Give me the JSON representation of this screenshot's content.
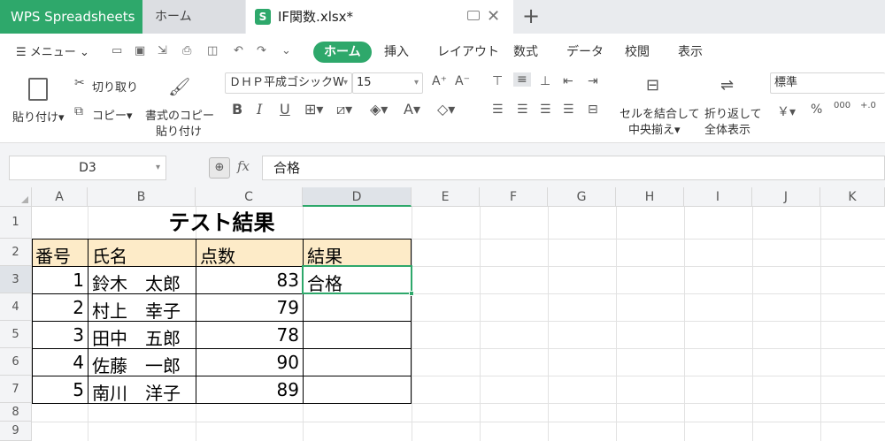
{
  "window": {
    "app_tab": "WPS Spreadsheets",
    "home_tab": "ホーム",
    "file_tab": "IF関数.xlsx*",
    "file_icon": "S"
  },
  "menubar": {
    "menu_label": "メニュー",
    "tabs": [
      "ホーム",
      "挿入",
      "レイアウト",
      "数式",
      "データ",
      "校閲",
      "表示"
    ]
  },
  "ribbon": {
    "paste": "貼り付け",
    "cut": "切り取り",
    "copy": "コピー",
    "format_painter_line1": "書式のコピー",
    "format_painter_line2": "貼り付け",
    "font_name": "ＤＨＰ平成ゴシックW",
    "font_size": "15",
    "merge_line1": "セルを結合して",
    "merge_line2": "中央揃え",
    "wrap_line1": "折り返して",
    "wrap_line2": "全体表示",
    "number_format": "標準",
    "yen": "￥",
    "percent": "%",
    "thousands": "000"
  },
  "formula_bar": {
    "cell_ref": "D3",
    "fx": "fx",
    "value": "合格"
  },
  "sheet": {
    "columns": [
      "A",
      "B",
      "C",
      "D",
      "E",
      "F",
      "G",
      "H",
      "I",
      "J",
      "K"
    ],
    "rows": [
      "1",
      "2",
      "3",
      "4",
      "5",
      "6",
      "7",
      "8",
      "9"
    ],
    "title": "テスト結果",
    "headers": [
      "番号",
      "氏名",
      "点数",
      "結果"
    ],
    "records": [
      {
        "no": "1",
        "name": "鈴木　太郎",
        "score": "83",
        "result": "合格"
      },
      {
        "no": "2",
        "name": "村上　幸子",
        "score": "79",
        "result": ""
      },
      {
        "no": "3",
        "name": "田中　五郎",
        "score": "78",
        "result": ""
      },
      {
        "no": "4",
        "name": "佐藤　一郎",
        "score": "90",
        "result": ""
      },
      {
        "no": "5",
        "name": "南川　洋子",
        "score": "89",
        "result": ""
      }
    ],
    "accent": "#2ea86b",
    "header_fill": "#fdebc8"
  }
}
